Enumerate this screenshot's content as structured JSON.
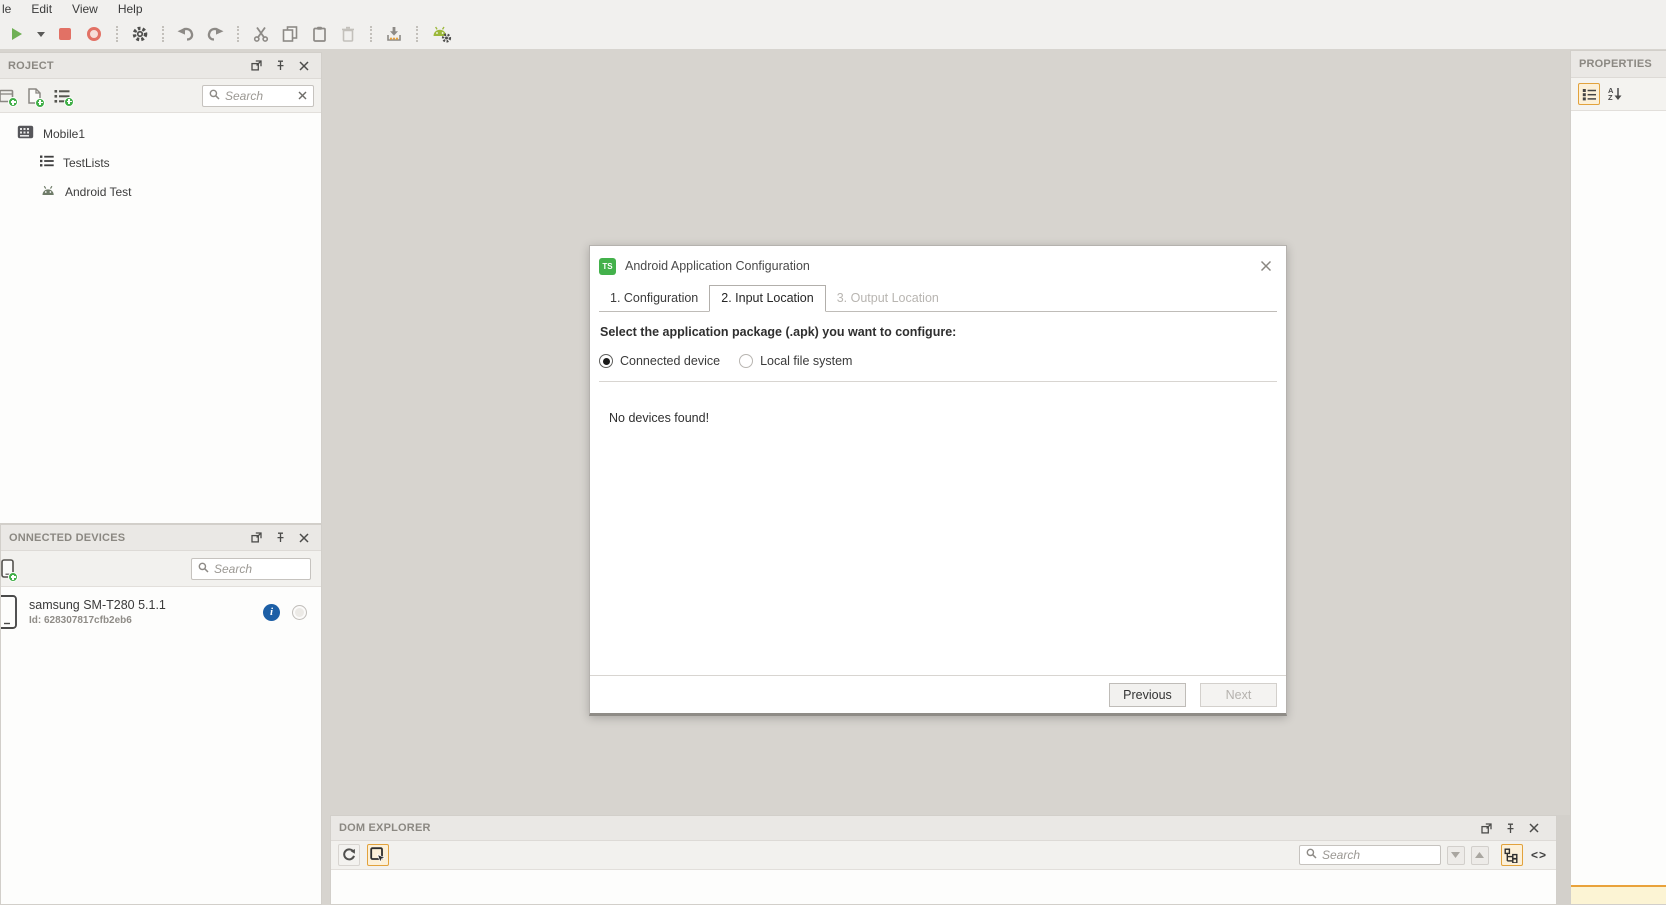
{
  "menu": {
    "items": [
      {
        "label": "le"
      },
      {
        "label": "Edit"
      },
      {
        "label": "View"
      },
      {
        "label": "Help"
      }
    ]
  },
  "toolbar": {
    "icons": [
      "run",
      "run-options",
      "stop",
      "record",
      "settings",
      "undo",
      "redo",
      "cut",
      "copy",
      "paste",
      "delete",
      "install-package",
      "android-settings"
    ]
  },
  "project_panel": {
    "title": "ROJECT",
    "search": {
      "placeholder": "Search"
    },
    "tree": [
      {
        "label": "Mobile1"
      },
      {
        "label": "TestLists"
      },
      {
        "label": "Android Test"
      }
    ]
  },
  "devices_panel": {
    "title": "ONNECTED DEVICES",
    "search": {
      "placeholder": "Search"
    },
    "device": {
      "name": "samsung SM-T280 5.1.1",
      "id": "Id: 628307817cfb2eb6",
      "info_glyph": "i"
    }
  },
  "dialog": {
    "app_icon_text": "TS",
    "title": "Android Application Configuration",
    "tabs": [
      {
        "label": "1. Configuration"
      },
      {
        "label": "2. Input Location"
      },
      {
        "label": "3. Output Location"
      }
    ],
    "prompt": "Select the application package (.apk) you want to configure:",
    "radios": [
      {
        "label": "Connected device",
        "selected": true
      },
      {
        "label": "Local file system",
        "selected": false
      }
    ],
    "message": "No devices found!",
    "previous_label": "Previous",
    "next_label": "Next"
  },
  "dom_explorer": {
    "title": "DOM EXPLORER",
    "search": {
      "placeholder": "Search"
    },
    "code_icon_text": "<>"
  },
  "properties_panel": {
    "title": "PROPERTIES",
    "sort_a": "A",
    "sort_z": "Z"
  },
  "colors": {
    "accent_orange": "#E9A23B",
    "highlight_bg": "#FCF0D8",
    "green": "#43B14B",
    "android_green": "#9CB83A",
    "record_red": "#E27165",
    "info_blue": "#1D5FA6",
    "canvas": "#D7D4CF",
    "panel_title_text": "#8B8882"
  }
}
